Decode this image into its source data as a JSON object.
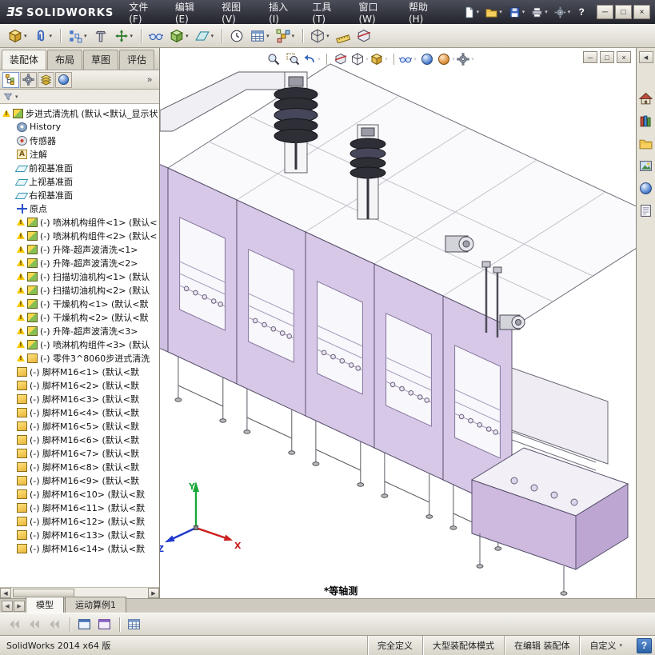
{
  "titlebar": {
    "logo_mark": "ƎS",
    "logo_name": "SOLIDWORKS",
    "menus": [
      {
        "label": "文件(F)"
      },
      {
        "label": "编辑(E)"
      },
      {
        "label": "视图(V)"
      },
      {
        "label": "插入(I)"
      },
      {
        "label": "工具(T)"
      },
      {
        "label": "窗口(W)"
      },
      {
        "label": "帮助(H)"
      }
    ],
    "quick_buttons": [
      {
        "name": "new-document-button",
        "sym": "#s-page",
        "dropdown": true
      },
      {
        "name": "open-button",
        "sym": "#s-folder",
        "dropdown": true
      },
      {
        "name": "save-button",
        "sym": "#s-save",
        "dropdown": true
      },
      {
        "name": "print-button",
        "sym": "#s-print",
        "dropdown": true
      },
      {
        "name": "options-button",
        "sym": "#s-gear",
        "dropdown": true
      }
    ],
    "help_label": "?",
    "window_buttons": [
      {
        "name": "minimize-button",
        "glyph": "─"
      },
      {
        "name": "maximize-button",
        "glyph": "□"
      },
      {
        "name": "close-button",
        "glyph": "×"
      }
    ]
  },
  "main_toolbar": {
    "buttons": [
      {
        "name": "insert-component-button",
        "sym": "#s-cube",
        "dropdown": true
      },
      {
        "name": "mate-button",
        "sym": "#s-clip",
        "dropdown": true
      },
      {
        "name": "linear-component-pattern-button",
        "sym": "#s-pattern",
        "dropdown": true,
        "gap": true
      },
      {
        "name": "smart-fasteners-button",
        "sym": "#s-bolt"
      },
      {
        "name": "move-component-button",
        "sym": "#s-move",
        "dropdown": true
      },
      {
        "name": "show-hidden-components-button",
        "sym": "#s-glasses",
        "gap": true
      },
      {
        "name": "assembly-features-button",
        "sym": "#s-cubeg",
        "dropdown": true
      },
      {
        "name": "reference-geometry-button",
        "sym": "#s-plane",
        "dropdown": true
      },
      {
        "name": "new-motion-study-button",
        "sym": "#s-clock",
        "gap": true
      },
      {
        "name": "bill-of-materials-button",
        "sym": "#s-table",
        "dropdown": true
      },
      {
        "name": "exploded-view-button",
        "sym": "#s-explode",
        "dropdown": true
      },
      {
        "name": "interference-detection-button",
        "sym": "#s-wirecube",
        "dropdown": true,
        "gap": true
      },
      {
        "name": "measure-button",
        "sym": "#s-ruler"
      },
      {
        "name": "section-tool-button",
        "sym": "#s-section"
      }
    ]
  },
  "command_manager": {
    "tabs": [
      {
        "label": "装配体",
        "active": true
      },
      {
        "label": "布局"
      },
      {
        "label": "草图"
      },
      {
        "label": "评估"
      }
    ]
  },
  "headsup_toolbar": {
    "buttons": [
      {
        "name": "zoom-fit-button",
        "sym": "#s-magnifier"
      },
      {
        "name": "zoom-area-button",
        "sym": "#s-magarea"
      },
      {
        "name": "previous-view-button",
        "sym": "#s-arrowback",
        "dropdown": true
      },
      {
        "name": "section-view-button",
        "sym": "#s-section",
        "gap": true
      },
      {
        "name": "view-orientation-button",
        "sym": "#s-wirecube",
        "dropdown": true
      },
      {
        "name": "display-style-button",
        "sym": "#s-cube",
        "dropdown": true
      },
      {
        "name": "hide-show-items-button",
        "sym": "#s-glasses",
        "dropdown": true,
        "gap": true
      },
      {
        "name": "edit-appearance-button",
        "sym": "#s-sphere"
      },
      {
        "name": "apply-scene-button",
        "sym": "#s-sphere2",
        "dropdown": true
      },
      {
        "name": "view-settings-button",
        "sym": "#s-gear",
        "dropdown": true
      }
    ]
  },
  "document_window": {
    "buttons": [
      {
        "name": "doc-minimize-button",
        "glyph": "─"
      },
      {
        "name": "doc-restore-button",
        "glyph": "□"
      },
      {
        "name": "doc-close-button",
        "glyph": "×"
      }
    ]
  },
  "feature_panel": {
    "tabs": [
      {
        "name": "featuremanager-tab",
        "sym": "#s-tree",
        "active": true
      },
      {
        "name": "propertymanager-tab",
        "sym": "#s-gear"
      },
      {
        "name": "configurationmanager-tab",
        "sym": "#s-config"
      },
      {
        "name": "displaymanager-tab",
        "sym": "#s-sphere"
      }
    ],
    "overflow_glyph": "»",
    "filter_arrow": "▾"
  },
  "feature_tree": {
    "warning_glyph": "!",
    "items": [
      {
        "icon": "asm",
        "warning": true,
        "label": "步进式清洗机 (默认<默认_显示状"
      },
      {
        "icon": "history",
        "ind": 1,
        "label": "History"
      },
      {
        "icon": "sensor",
        "ind": 1,
        "label": "传感器"
      },
      {
        "icon": "annot",
        "ind": 1,
        "label": "注解"
      },
      {
        "icon": "plane",
        "ind": 1,
        "label": "前视基准面"
      },
      {
        "icon": "plane",
        "ind": 1,
        "label": "上视基准面"
      },
      {
        "icon": "plane",
        "ind": 1,
        "label": "右视基准面"
      },
      {
        "icon": "origin",
        "ind": 1,
        "label": "原点"
      },
      {
        "icon": "asm",
        "ind": 1,
        "warning": true,
        "label": "(-) 喷淋机构组件<1> (默认<"
      },
      {
        "icon": "asm",
        "ind": 1,
        "warning": true,
        "label": "(-) 喷淋机构组件<2> (默认<"
      },
      {
        "icon": "asm",
        "ind": 1,
        "warning": true,
        "label": "(-) 升降-超声波清洗<1>"
      },
      {
        "icon": "asm",
        "ind": 1,
        "warning": true,
        "label": "(-) 升降-超声波清洗<2>"
      },
      {
        "icon": "asm",
        "ind": 1,
        "warning": true,
        "label": "(-) 扫描切油机构<1> (默认"
      },
      {
        "icon": "asm",
        "ind": 1,
        "warning": true,
        "label": "(-) 扫描切油机构<2> (默认"
      },
      {
        "icon": "asm",
        "ind": 1,
        "warning": true,
        "label": "(-) 干燥机构<1> (默认<默"
      },
      {
        "icon": "asm",
        "ind": 1,
        "warning": true,
        "label": "(-) 干燥机构<2> (默认<默"
      },
      {
        "icon": "asm",
        "ind": 1,
        "warning": true,
        "label": "(-) 升降-超声波清洗<3>"
      },
      {
        "icon": "asm",
        "ind": 1,
        "warning": true,
        "label": "(-) 喷淋机构组件<3> (默认"
      },
      {
        "icon": "part",
        "ind": 1,
        "warning": true,
        "label": "(-) 零件3^8060步进式清洗"
      },
      {
        "icon": "part",
        "ind": 1,
        "label": "(-) 脚杯M16<1> (默认<默"
      },
      {
        "icon": "part",
        "ind": 1,
        "label": "(-) 脚杯M16<2> (默认<默"
      },
      {
        "icon": "part",
        "ind": 1,
        "label": "(-) 脚杯M16<3> (默认<默"
      },
      {
        "icon": "part",
        "ind": 1,
        "label": "(-) 脚杯M16<4> (默认<默"
      },
      {
        "icon": "part",
        "ind": 1,
        "label": "(-) 脚杯M16<5> (默认<默"
      },
      {
        "icon": "part",
        "ind": 1,
        "label": "(-) 脚杯M16<6> (默认<默"
      },
      {
        "icon": "part",
        "ind": 1,
        "label": "(-) 脚杯M16<7> (默认<默"
      },
      {
        "icon": "part",
        "ind": 1,
        "label": "(-) 脚杯M16<8> (默认<默"
      },
      {
        "icon": "part",
        "ind": 1,
        "label": "(-) 脚杯M16<9> (默认<默"
      },
      {
        "icon": "part",
        "ind": 1,
        "label": "(-) 脚杯M16<10> (默认<默"
      },
      {
        "icon": "part",
        "ind": 1,
        "label": "(-) 脚杯M16<11> (默认<默"
      },
      {
        "icon": "part",
        "ind": 1,
        "label": "(-) 脚杯M16<12> (默认<默"
      },
      {
        "icon": "part",
        "ind": 1,
        "label": "(-) 脚杯M16<13> (默认<默"
      },
      {
        "icon": "part",
        "ind": 1,
        "label": "(-) 脚杯M16<14> (默认<默"
      }
    ]
  },
  "viewport": {
    "view_label": "*等轴测",
    "triad": {
      "x": "X",
      "y": "Y",
      "z": "Z"
    }
  },
  "task_pane": {
    "collapse_glyph": "◀",
    "icons": [
      {
        "name": "solidworks-resources-tab",
        "sym": "#s-home"
      },
      {
        "name": "design-library-tab",
        "sym": "#s-books"
      },
      {
        "name": "file-explorer-tab",
        "sym": "#s-folder"
      },
      {
        "name": "view-palette-tab",
        "sym": "#s-photo"
      },
      {
        "name": "appearances-scenes-tab",
        "sym": "#s-sphere"
      },
      {
        "name": "custom-properties-tab",
        "sym": "#s-props"
      }
    ]
  },
  "doc_tabs": {
    "scroll_left": "◀",
    "scroll_right": "▶",
    "items": [
      {
        "label": "模型",
        "active": true
      },
      {
        "label": "运动算例1"
      }
    ]
  },
  "bottom_toolbar": {
    "buttons": [
      {
        "name": "nav-first-button",
        "sym": "#s-nav",
        "disabled": true
      },
      {
        "name": "nav-prev-button",
        "sym": "#s-nav",
        "disabled": true
      },
      {
        "name": "nav-next-button",
        "sym": "#s-nav",
        "disabled": true
      },
      {
        "name": "new-window-button",
        "sym": "#s-window",
        "gap": true
      },
      {
        "name": "split-window-button",
        "sym": "#s-window2"
      },
      {
        "name": "design-table-button",
        "sym": "#s-table",
        "gap": true
      }
    ]
  },
  "status_bar": {
    "left_text": "SolidWorks 2014 x64 版",
    "fields": [
      {
        "label": "完全定义"
      },
      {
        "label": "大型装配体模式"
      },
      {
        "label": "在编辑 装配体"
      }
    ],
    "custom_label": "自定义",
    "custom_arrow": "▾",
    "help_label": "?"
  }
}
